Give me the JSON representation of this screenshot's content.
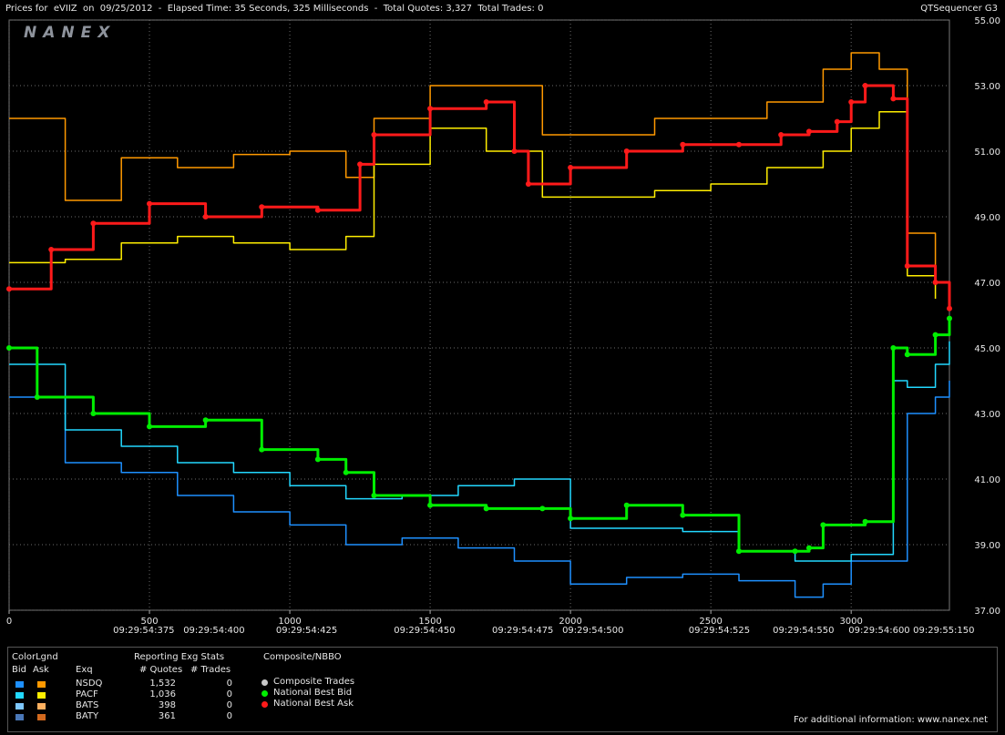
{
  "header": {
    "title": "Prices for  eVIIZ  on  09/25/2012  -  Elapsed Time: 35 Seconds, 325 Milliseconds  -  Total Quotes: 3,327  Total Trades: 0",
    "app_name": "QTSequencer G3"
  },
  "watermark": "NANEX",
  "chart_data": {
    "type": "line",
    "y_ticks": [
      "55.00",
      "53.00",
      "51.00",
      "49.00",
      "47.00",
      "45.00",
      "43.00",
      "41.00",
      "39.00",
      "37.00"
    ],
    "ylim": [
      37,
      55
    ],
    "xlim": [
      0,
      3350
    ],
    "x_ticks": [
      "0",
      "500",
      "1000",
      "1500",
      "2000",
      "2500",
      "3000"
    ],
    "x_tick_values": [
      0,
      500,
      1000,
      1500,
      2000,
      2500,
      3000
    ],
    "time_labels": [
      {
        "label": "09:29:54:375",
        "x": 480
      },
      {
        "label": "09:29:54:400",
        "x": 730
      },
      {
        "label": "09:29:54:425",
        "x": 1060
      },
      {
        "label": "09:29:54:450",
        "x": 1480
      },
      {
        "label": "09:29:54:475",
        "x": 1830
      },
      {
        "label": "09:29:54:500",
        "x": 2080
      },
      {
        "label": "09:29:54:525",
        "x": 2530
      },
      {
        "label": "09:29:54:550",
        "x": 2830
      },
      {
        "label": "09:29:54:600",
        "x": 3100
      },
      {
        "label": "09:29:55:150",
        "x": 3330
      }
    ],
    "grid": true,
    "series": [
      {
        "name": "National Best Ask",
        "color": "#ff1a1a",
        "x": [
          0,
          150,
          300,
          500,
          700,
          900,
          1100,
          1250,
          1300,
          1500,
          1700,
          1800,
          1850,
          2000,
          2200,
          2400,
          2600,
          2750,
          2850,
          2950,
          3000,
          3050,
          3150,
          3200,
          3300,
          3350
        ],
        "y": [
          46.8,
          48.0,
          48.8,
          49.4,
          49.0,
          49.3,
          49.2,
          50.6,
          51.5,
          52.3,
          52.5,
          51.0,
          50.0,
          50.5,
          51.0,
          51.2,
          51.2,
          51.5,
          51.6,
          51.9,
          52.5,
          53.0,
          52.6,
          47.5,
          47.0,
          46.2
        ]
      },
      {
        "name": "National Best Bid",
        "color": "#00ee00",
        "x": [
          0,
          100,
          300,
          500,
          700,
          900,
          1100,
          1200,
          1300,
          1500,
          1700,
          1900,
          2000,
          2200,
          2400,
          2600,
          2800,
          2850,
          2900,
          3050,
          3150,
          3200,
          3300,
          3350
        ],
        "y": [
          45.0,
          43.5,
          43.0,
          42.6,
          42.8,
          41.9,
          41.6,
          41.2,
          40.5,
          40.2,
          40.1,
          40.1,
          39.8,
          40.2,
          39.9,
          38.8,
          38.8,
          38.9,
          39.6,
          39.7,
          45.0,
          44.8,
          45.4,
          45.9
        ]
      },
      {
        "name": "NSDQ Ask",
        "color": "#ff9900",
        "x": [
          0,
          200,
          400,
          600,
          800,
          1000,
          1200,
          1300,
          1500,
          1700,
          1900,
          2100,
          2300,
          2500,
          2700,
          2900,
          3000,
          3100,
          3200,
          3300,
          3350
        ],
        "y": [
          52.0,
          49.5,
          50.8,
          50.5,
          50.9,
          51.0,
          50.2,
          52.0,
          53.0,
          53.0,
          51.5,
          51.5,
          52.0,
          52.0,
          52.5,
          53.5,
          54.0,
          53.5,
          48.5,
          47.0,
          46.2
        ]
      },
      {
        "name": "PACF Ask",
        "color": "#ffee00",
        "x": [
          0,
          200,
          400,
          600,
          800,
          1000,
          1200,
          1300,
          1500,
          1700,
          1900,
          2100,
          2300,
          2500,
          2700,
          2900,
          3000,
          3100,
          3200,
          3300
        ],
        "y": [
          47.6,
          47.7,
          48.2,
          48.4,
          48.2,
          48.0,
          48.4,
          50.6,
          51.7,
          51.0,
          49.6,
          49.6,
          49.8,
          50.0,
          50.5,
          51.0,
          51.7,
          52.2,
          47.2,
          46.5
        ]
      },
      {
        "name": "NSDQ Bid",
        "color": "#1e90ff",
        "x": [
          0,
          200,
          400,
          600,
          800,
          1000,
          1200,
          1400,
          1600,
          1800,
          2000,
          2200,
          2400,
          2600,
          2800,
          2900,
          3000,
          3150,
          3200,
          3300,
          3350
        ],
        "y": [
          43.5,
          41.5,
          41.2,
          40.5,
          40.0,
          39.6,
          39.0,
          39.2,
          38.9,
          38.5,
          37.8,
          38.0,
          38.1,
          37.9,
          37.4,
          37.8,
          38.5,
          38.5,
          43.0,
          43.5,
          44.0
        ]
      },
      {
        "name": "PACF Bid",
        "color": "#22d8ff",
        "x": [
          0,
          200,
          400,
          600,
          800,
          1000,
          1200,
          1400,
          1600,
          1800,
          2000,
          2200,
          2400,
          2600,
          2800,
          3000,
          3150,
          3200,
          3300,
          3350
        ],
        "y": [
          44.5,
          42.5,
          42.0,
          41.5,
          41.2,
          40.8,
          40.4,
          40.5,
          40.8,
          41.0,
          39.5,
          39.5,
          39.4,
          38.8,
          38.5,
          38.7,
          44.0,
          43.8,
          44.5,
          45.2
        ]
      }
    ]
  },
  "legend": {
    "colorlegend": {
      "title": "ColorLgnd",
      "bid_header": "Bid",
      "ask_header": "Ask"
    },
    "stats": {
      "title": "Reporting Exg Stats",
      "exg_header": "Exq",
      "quotes_header": "# Quotes",
      "trades_header": "# Trades"
    },
    "rows": [
      {
        "exchange": "NSDQ",
        "quotes": "1,532",
        "trades": "0",
        "bid_color": "#1e90ff",
        "ask_color": "#ff9900"
      },
      {
        "exchange": "PACF",
        "quotes": "1,036",
        "trades": "0",
        "bid_color": "#22d8ff",
        "ask_color": "#ffee00"
      },
      {
        "exchange": "BATS",
        "quotes": "398",
        "trades": "0",
        "bid_color": "#7ec8ff",
        "ask_color": "#ffb060"
      },
      {
        "exchange": "BATY",
        "quotes": "361",
        "trades": "0",
        "bid_color": "#4a78b8",
        "ask_color": "#d2691e"
      }
    ],
    "composite": {
      "title": "Composite/NBBO",
      "items": [
        {
          "label": "Composite Trades",
          "color": "#c8c8c8"
        },
        {
          "label": "National Best Bid",
          "color": "#00ee00"
        },
        {
          "label": "National Best Ask",
          "color": "#ff1a1a"
        }
      ]
    },
    "footer": "For additional information: www.nanex.net"
  }
}
